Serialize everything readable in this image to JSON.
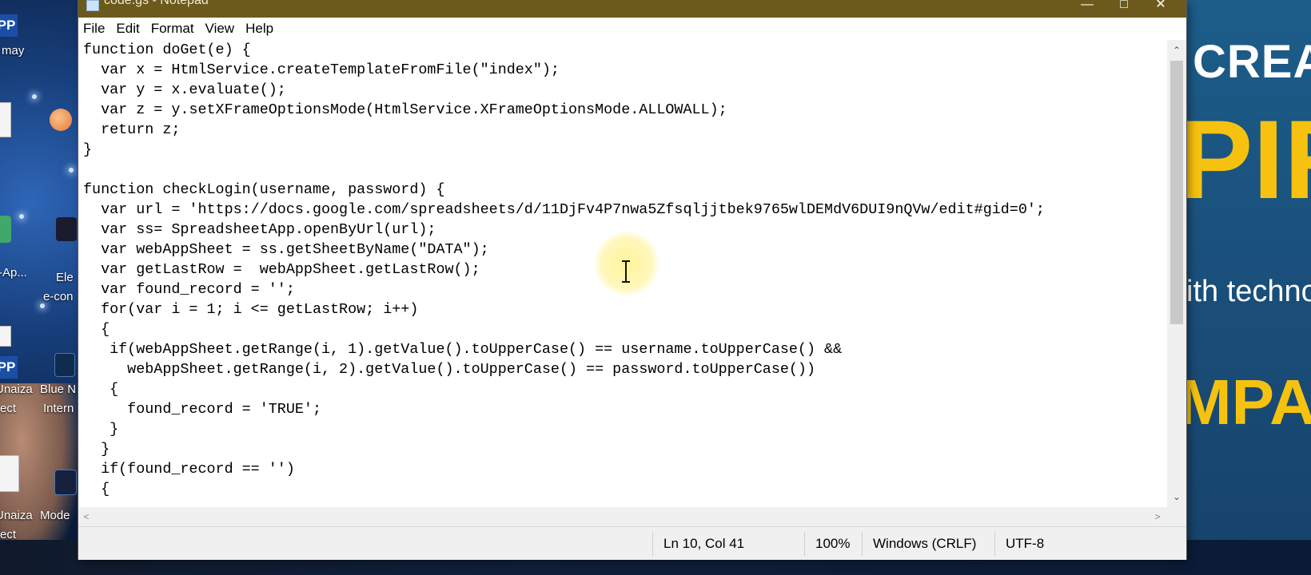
{
  "window": {
    "title": "code.gs - Notepad",
    "controls": [
      "minimize",
      "maximize",
      "close"
    ]
  },
  "menu": [
    "File",
    "Edit",
    "Format",
    "View",
    "Help"
  ],
  "code_lines": [
    "function doGet(e) {",
    "  var x = HtmlService.createTemplateFromFile(\"index\");",
    "  var y = x.evaluate();",
    "  var z = y.setXFrameOptionsMode(HtmlService.XFrameOptionsMode.ALLOWALL);",
    "  return z;",
    "}",
    "",
    "function checkLogin(username, password) {",
    "  var url = 'https://docs.google.com/spreadsheets/d/11DjFv4P7nwa5Zfsqljjtbek9765wlDEMdV6DUI9nQVw/edit#gid=0';",
    "  var ss= SpreadsheetApp.openByUrl(url);",
    "  var webAppSheet = ss.getSheetByName(\"DATA\");",
    "  var getLastRow =  webAppSheet.getLastRow();",
    "  var found_record = '';",
    "  for(var i = 1; i <= getLastRow; i++)",
    "  {",
    "   if(webAppSheet.getRange(i, 1).getValue().toUpperCase() == username.toUpperCase() &&",
    "     webAppSheet.getRange(i, 2).getValue().toUpperCase() == password.toUpperCase())",
    "   {",
    "     found_record = 'TRUE';",
    "   }",
    "  }",
    "  if(found_record == '')",
    "  {"
  ],
  "status": {
    "position": "Ln 10, Col 41",
    "zoom": "100%",
    "line_ending": "Windows (CRLF)",
    "encoding": "UTF-8"
  },
  "desktop": {
    "labels": [
      "may",
      "-Ap...",
      "Ele",
      "e-con",
      "Unaiza",
      "Blue N",
      "ect",
      "Intern",
      "Unaiza",
      "Mode",
      "ect"
    ],
    "app_badges": [
      "PP",
      "PP"
    ]
  },
  "banner": {
    "line1": "CREA",
    "line2": "PIR",
    "line3": "ith techno",
    "line4": "MPAN"
  }
}
